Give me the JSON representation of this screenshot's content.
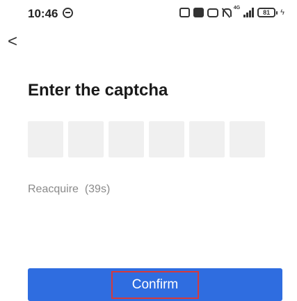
{
  "status_bar": {
    "time": "10:46",
    "network_label": "4G",
    "battery_level": "81",
    "icons": [
      "dnd-icon",
      "nfc-icon",
      "sim-icon",
      "mute-icon",
      "signal-icon",
      "battery-icon",
      "charging-icon"
    ]
  },
  "nav": {
    "back_glyph": "<"
  },
  "page": {
    "title": "Enter the captcha",
    "captcha_slots": 6,
    "reacquire_text": "Reacquire  (39s)",
    "confirm_label": "Confirm"
  },
  "colors": {
    "primary": "#2f6de0",
    "slot_bg": "#f0f0f0",
    "muted_text": "#8a8a8a",
    "highlight_border": "#d63a3a"
  }
}
